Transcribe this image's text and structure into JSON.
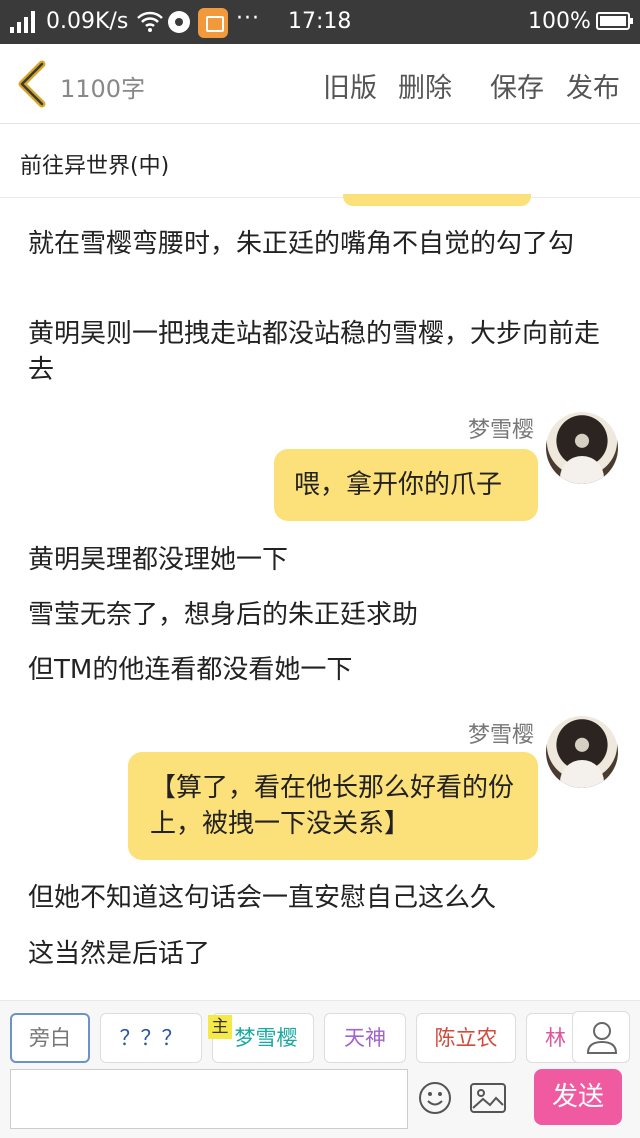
{
  "status_bar": {
    "network_speed": "0.09K/s",
    "dots": "···",
    "time": "17:18",
    "battery": "100%"
  },
  "toolbar": {
    "word_count": "1100字",
    "old_version": "旧版",
    "delete": "删除",
    "save": "保存",
    "publish": "发布"
  },
  "chapter": {
    "title": "前往异世界(中)"
  },
  "content": {
    "narration_1": "就在雪樱弯腰时，朱正廷的嘴角不自觉的勾了勾",
    "narration_2": "黄明昊则一把拽走站都没站稳的雪樱，大步向前走去",
    "msg_1_sender": "梦雪樱",
    "msg_1_text": "喂，拿开你的爪子",
    "narration_3": "黄明昊理都没理她一下",
    "narration_4": "雪莹无奈了，想身后的朱正廷求助",
    "narration_5": "但TM的他连看都没看她一下",
    "msg_2_sender": "梦雪樱",
    "msg_2_text": "【算了，看在他长那么好看的份上，被拽一下没关系】",
    "narration_6": "但她不知道这句话会一直安慰自己这么久",
    "narration_7": "这当然是后话了"
  },
  "character_bar": {
    "chips": [
      "旁白",
      "？？？",
      "梦雪樱",
      "天神",
      "陈立农",
      "林"
    ],
    "host_tag": "主",
    "input_value": "",
    "send": "发送"
  },
  "colors": {
    "bubble": "#fce07a",
    "send_button": "#f05aa0",
    "selected_chip_border": "#6b93c9"
  }
}
